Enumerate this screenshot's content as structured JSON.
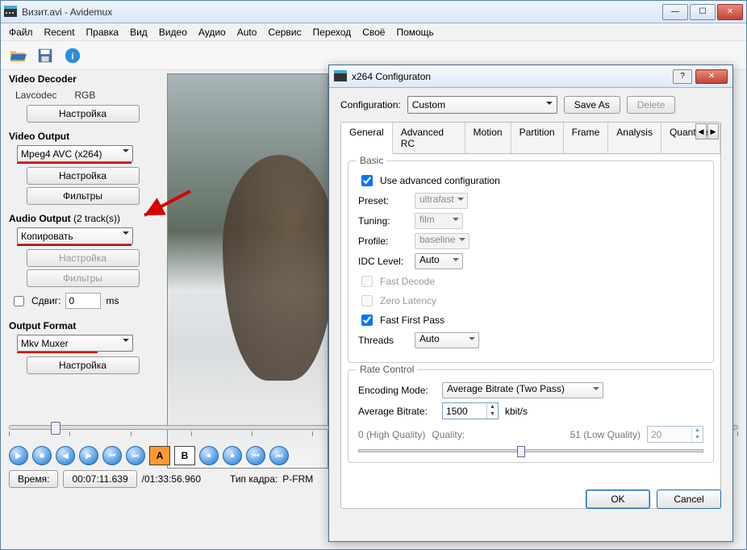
{
  "window": {
    "title": "Визит.avi - Avidemux"
  },
  "menu": [
    "Файл",
    "Recent",
    "Правка",
    "Вид",
    "Видео",
    "Аудио",
    "Auto",
    "Сервис",
    "Переход",
    "Своё",
    "Помощь"
  ],
  "left": {
    "videoDecoder": {
      "title": "Video Decoder",
      "codec": "Lavcodec",
      "rgb": "RGB",
      "settings": "Настройка"
    },
    "videoOutput": {
      "title": "Video Output",
      "select": "Mpeg4 AVC (x264)",
      "settings": "Настройка",
      "filters": "Фильтры"
    },
    "audioOutput": {
      "title": "Audio Output",
      "tracks": "(2 track(s))",
      "select": "Копировать",
      "settings": "Настройка",
      "filters": "Фильтры",
      "shiftLabel": "Сдвиг:",
      "shiftValue": "0",
      "shiftUnit": "ms"
    },
    "outputFormat": {
      "title": "Output Format",
      "select": "Mkv Muxer",
      "settings": "Настройка"
    }
  },
  "bottom": {
    "timeLabel": "Время:",
    "time": "00:07:11.639",
    "duration": "/01:33:56.960",
    "frameTypeLabel": "Тип кадра:",
    "frameType": "P-FRM"
  },
  "dialog": {
    "title": "x264 Configuraton",
    "configLabel": "Configuration:",
    "configValue": "Custom",
    "saveAs": "Save As",
    "delete": "Delete",
    "tabs": [
      "General",
      "Advanced RC",
      "Motion",
      "Partition",
      "Frame",
      "Analysis",
      "Quantiser"
    ],
    "basic": {
      "title": "Basic",
      "useAdvanced": "Use advanced configuration",
      "presetLabel": "Preset:",
      "preset": "ultrafast",
      "tuningLabel": "Tuning:",
      "tuning": "film",
      "profileLabel": "Profile:",
      "profile": "baseline",
      "idcLabel": "IDC Level:",
      "idc": "Auto",
      "fastDecode": "Fast Decode",
      "zeroLatency": "Zero Latency",
      "fastFirstPass": "Fast First Pass",
      "threadsLabel": "Threads",
      "threads": "Auto"
    },
    "rate": {
      "title": "Rate Control",
      "encModeLabel": "Encoding Mode:",
      "encMode": "Average Bitrate (Two Pass)",
      "avgBitrateLabel": "Average Bitrate:",
      "avgBitrate": "1500",
      "unit": "kbit/s",
      "hq": "0 (High Quality)",
      "qLabel": "Quality:",
      "lq": "51 (Low Quality)",
      "qVal": "20"
    },
    "ok": "OK",
    "cancel": "Cancel"
  }
}
